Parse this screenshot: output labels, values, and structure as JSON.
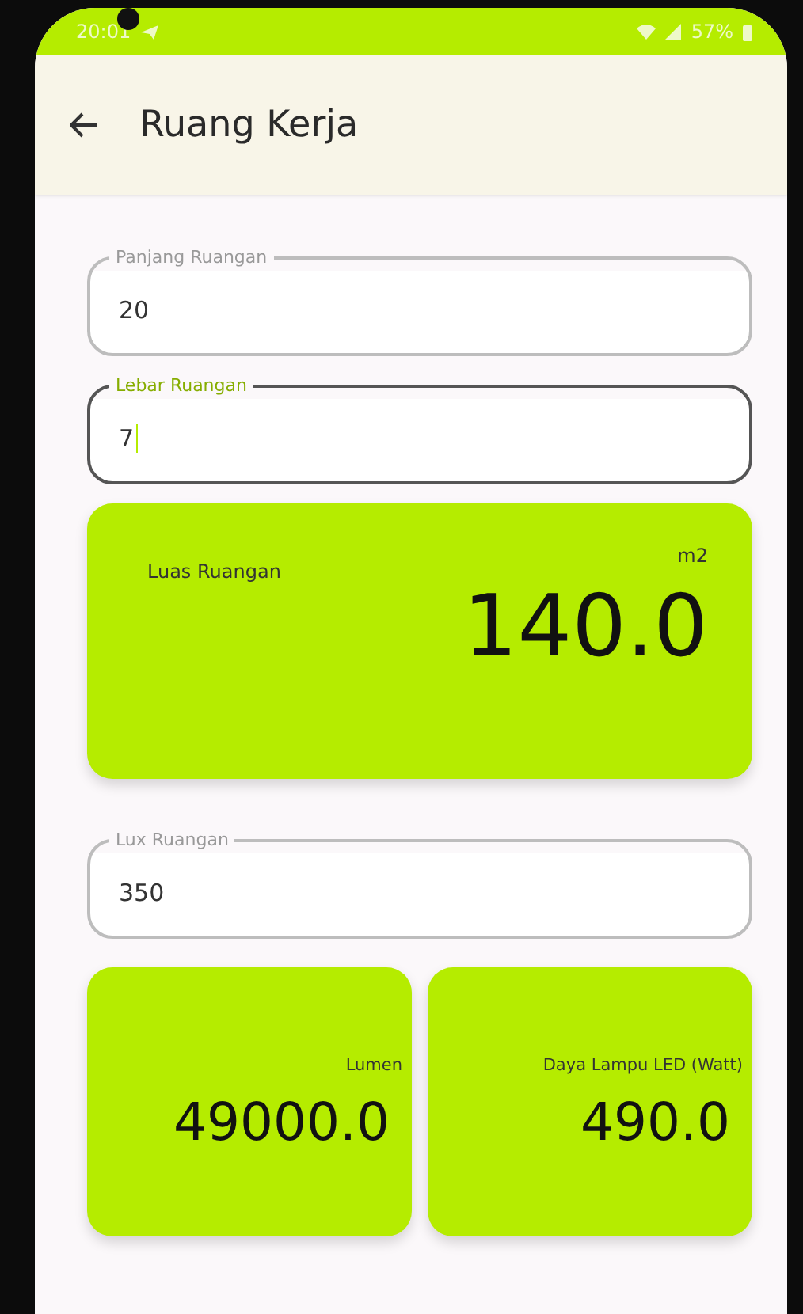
{
  "status_bar": {
    "time": "20:01",
    "battery": "57%"
  },
  "app_bar": {
    "title": "Ruang Kerja"
  },
  "fields": [
    {
      "label": "Panjang Ruangan",
      "value": "20",
      "focused": false
    },
    {
      "label": "Lebar Ruangan",
      "value": "7",
      "focused": true
    }
  ],
  "area_card": {
    "label": "Luas Ruangan",
    "unit": "m2",
    "value": "140.0"
  },
  "lux_field": {
    "label": "Lux Ruangan",
    "value": "350",
    "focused": false
  },
  "result_cards": [
    {
      "label": "Lumen",
      "value": "49000.0"
    },
    {
      "label": "Daya Lampu LED (Watt)",
      "value": "490.0"
    }
  ]
}
